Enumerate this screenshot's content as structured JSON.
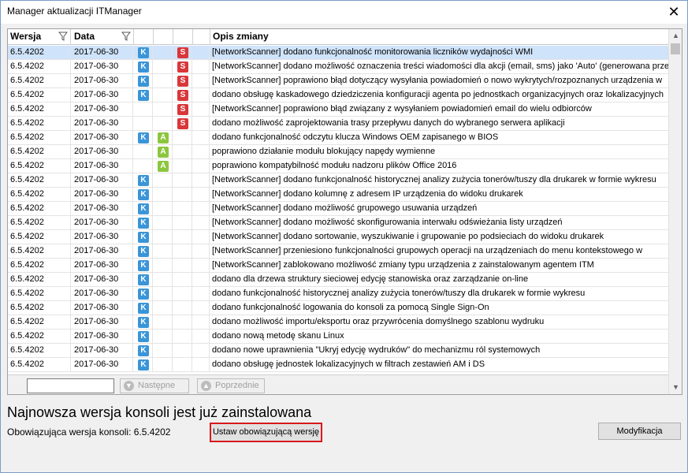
{
  "window": {
    "title": "Manager aktualizacji ITManager",
    "close_glyph": "✕"
  },
  "grid": {
    "columns": {
      "version": "Wersja",
      "date": "Data",
      "description": "Opis zmiany"
    },
    "rows": [
      {
        "version": "6.5.4202",
        "date": "2017-06-30",
        "k": true,
        "a": false,
        "s": true,
        "description": "[NetworkScanner] dodano funkcjonalność monitorowania liczników wydajności WMI"
      },
      {
        "version": "6.5.4202",
        "date": "2017-06-30",
        "k": true,
        "a": false,
        "s": true,
        "description": "[NetworkScanner] dodano możliwość oznaczenia treści wiadomości dla akcji (email, sms) jako 'Auto' (generowana przez"
      },
      {
        "version": "6.5.4202",
        "date": "2017-06-30",
        "k": true,
        "a": false,
        "s": true,
        "description": "[NetworkScanner] poprawiono błąd dotyczący wysyłania powiadomień o nowo wykrytych/rozpoznanych urządzenia w"
      },
      {
        "version": "6.5.4202",
        "date": "2017-06-30",
        "k": true,
        "a": false,
        "s": true,
        "description": "dodano obsługę kaskadowego dziedziczenia konfiguracji agenta po jednostkach organizacyjnych oraz lokalizacyjnych"
      },
      {
        "version": "6.5.4202",
        "date": "2017-06-30",
        "k": false,
        "a": false,
        "s": true,
        "description": "[NetworkScanner] poprawiono błąd związany z wysyłaniem powiadomień email do wielu odbiorców"
      },
      {
        "version": "6.5.4202",
        "date": "2017-06-30",
        "k": false,
        "a": false,
        "s": true,
        "description": "dodano możliwość zaprojektowania trasy przepływu danych do wybranego serwera aplikacji"
      },
      {
        "version": "6.5.4202",
        "date": "2017-06-30",
        "k": true,
        "a": true,
        "s": false,
        "description": "dodano funkcjonalność odczytu klucza Windows OEM zapisanego w BIOS"
      },
      {
        "version": "6.5.4202",
        "date": "2017-06-30",
        "k": false,
        "a": true,
        "s": false,
        "description": "poprawiono działanie modułu blokujący napędy wymienne"
      },
      {
        "version": "6.5.4202",
        "date": "2017-06-30",
        "k": false,
        "a": true,
        "s": false,
        "description": "poprawiono kompatybilność modułu nadzoru plików Office 2016"
      },
      {
        "version": "6.5.4202",
        "date": "2017-06-30",
        "k": true,
        "a": false,
        "s": false,
        "description": "[NetworkScanner] dodano funkcjonalność historycznej analizy zużycia tonerów/tuszy dla drukarek w formie wykresu"
      },
      {
        "version": "6.5.4202",
        "date": "2017-06-30",
        "k": true,
        "a": false,
        "s": false,
        "description": "[NetworkScanner] dodano kolumnę z adresem IP urządzenia do widoku drukarek"
      },
      {
        "version": "6.5.4202",
        "date": "2017-06-30",
        "k": true,
        "a": false,
        "s": false,
        "description": "[NetworkScanner] dodano możliwość grupowego usuwania urządzeń"
      },
      {
        "version": "6.5.4202",
        "date": "2017-06-30",
        "k": true,
        "a": false,
        "s": false,
        "description": "[NetworkScanner] dodano możliwość skonfigurowania interwału odświeżania listy urządzeń"
      },
      {
        "version": "6.5.4202",
        "date": "2017-06-30",
        "k": true,
        "a": false,
        "s": false,
        "description": "[NetworkScanner] dodano sortowanie, wyszukiwanie i grupowanie po podsieciach do widoku drukarek"
      },
      {
        "version": "6.5.4202",
        "date": "2017-06-30",
        "k": true,
        "a": false,
        "s": false,
        "description": "[NetworkScanner] przeniesiono funkcjonalności grupowych operacji na urządzeniach do menu kontekstowego w"
      },
      {
        "version": "6.5.4202",
        "date": "2017-06-30",
        "k": true,
        "a": false,
        "s": false,
        "description": "[NetworkScanner] zablokowano możliwość zmiany typu urządzenia z zainstalowanym agentem ITM"
      },
      {
        "version": "6.5.4202",
        "date": "2017-06-30",
        "k": true,
        "a": false,
        "s": false,
        "description": "dodano dla drzewa struktury sieciowej edycję stanowiska oraz zarządzanie on-line"
      },
      {
        "version": "6.5.4202",
        "date": "2017-06-30",
        "k": true,
        "a": false,
        "s": false,
        "description": "dodano funkcjonalność historycznej analizy zużycia tonerów/tuszy dla drukarek w formie wykresu"
      },
      {
        "version": "6.5.4202",
        "date": "2017-06-30",
        "k": true,
        "a": false,
        "s": false,
        "description": "dodano funkcjonalność logowania do konsoli za pomocą Single Sign-On"
      },
      {
        "version": "6.5.4202",
        "date": "2017-06-30",
        "k": true,
        "a": false,
        "s": false,
        "description": "dodano możliwość importu/eksportu oraz przywrócenia domyślnego szablonu wydruku"
      },
      {
        "version": "6.5.4202",
        "date": "2017-06-30",
        "k": true,
        "a": false,
        "s": false,
        "description": "dodano nową metodę skanu Linux"
      },
      {
        "version": "6.5.4202",
        "date": "2017-06-30",
        "k": true,
        "a": false,
        "s": false,
        "description": "dodano nowe uprawnienia \"Ukryj edycję wydruków\" do mechanizmu ról systemowych"
      },
      {
        "version": "6.5.4202",
        "date": "2017-06-30",
        "k": true,
        "a": false,
        "s": false,
        "description": "dodano obsługę jednostek lokalizacyjnych w filtrach zestawień AM i DS"
      }
    ],
    "badges": {
      "k": "K",
      "a": "A",
      "s": "S"
    },
    "colors": {
      "k": "#3a95d8",
      "a": "#8cc63f",
      "s": "#d9373a",
      "selected_row": "#cfe3fa",
      "highlight_border": "#d7191c"
    },
    "nav": {
      "search_value": "",
      "next_label": "Następne",
      "prev_label": "Poprzednie"
    }
  },
  "status": {
    "title": "Najnowsza wersja konsoli jest już zainstalowana",
    "current_version": "Obowiązująca wersja konsoli: 6.5.4202"
  },
  "buttons": {
    "set_version": "Ustaw obowiązującą wersję",
    "modify": "Modyfikacja"
  }
}
